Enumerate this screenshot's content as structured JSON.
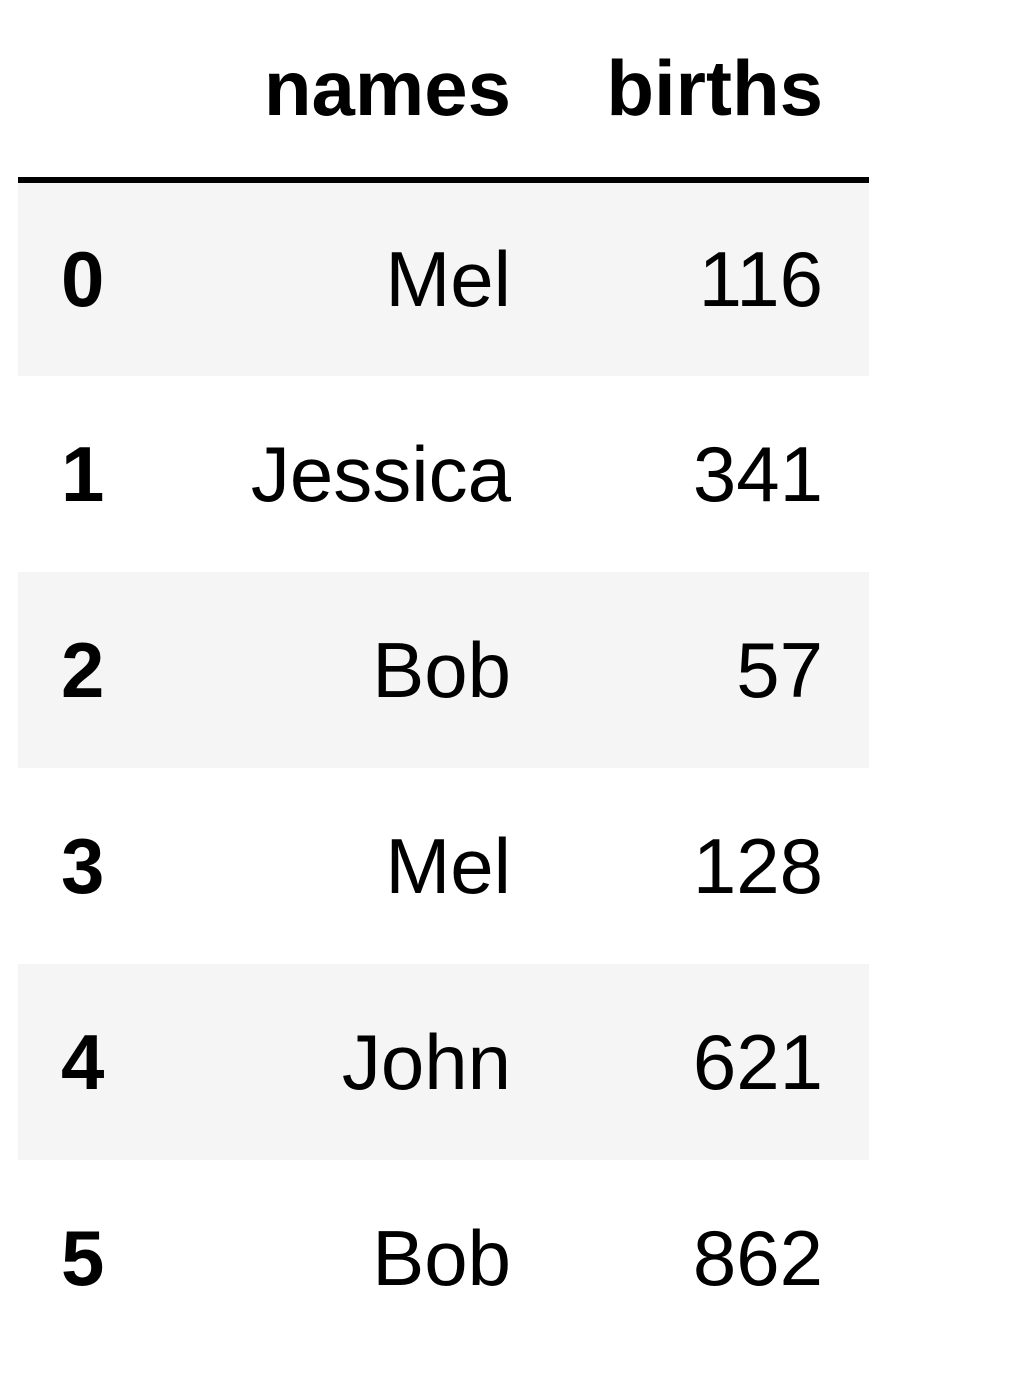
{
  "table": {
    "columns": [
      "names",
      "births"
    ],
    "rows": [
      {
        "index": "0",
        "names": "Mel",
        "births": "116"
      },
      {
        "index": "1",
        "names": "Jessica",
        "births": "341"
      },
      {
        "index": "2",
        "names": "Bob",
        "births": "57"
      },
      {
        "index": "3",
        "names": "Mel",
        "births": "128"
      },
      {
        "index": "4",
        "names": "John",
        "births": "621"
      },
      {
        "index": "5",
        "names": "Bob",
        "births": "862"
      }
    ]
  },
  "colors": {
    "stripe": "#f5f5f5",
    "header_rule": "#000000"
  }
}
